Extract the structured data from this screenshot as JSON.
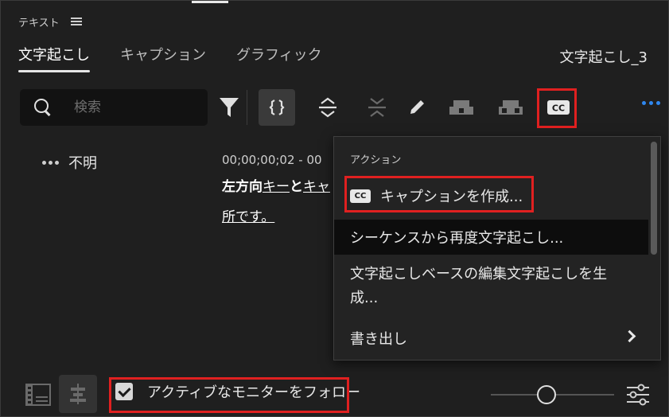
{
  "panel": {
    "title": "テキスト"
  },
  "tabs": [
    {
      "label": "文字起こし",
      "active": true
    },
    {
      "label": "キャプション",
      "active": false
    },
    {
      "label": "グラフィック",
      "active": false
    }
  ],
  "sequence_name": "文字起こし_3",
  "search": {
    "placeholder": "検索"
  },
  "toolbar": {
    "icons": [
      "filter-icon",
      "split-icon",
      "expand-icon",
      "collapse-icon",
      "pencil-icon",
      "merge-left-icon",
      "merge-right-icon",
      "cc-icon",
      "more-icon"
    ]
  },
  "transcript": {
    "speaker": "不明",
    "timecode": "00;00;00;02 - 00",
    "line1_bold": "左方向",
    "line1_ul1": "キー",
    "line1_mid": "と",
    "line1_ul2": "キャ",
    "line2": "所です。"
  },
  "menu": {
    "section_label": "アクション",
    "items": [
      {
        "label": "キャプションを作成..."
      },
      {
        "label": "シーケンスから再度文字起こし..."
      },
      {
        "label": "文字起こしベースの編集文字起こしを生成..."
      },
      {
        "label": "書き出し"
      }
    ],
    "cc_badge": "CC"
  },
  "footer": {
    "follow_monitor_label": "アクティブなモニターをフォロー",
    "follow_monitor_checked": true,
    "zoom_level": 0.45
  },
  "colors": {
    "accent": "#2f88f0",
    "highlight": "#e02020",
    "background": "#1f1f1f"
  }
}
